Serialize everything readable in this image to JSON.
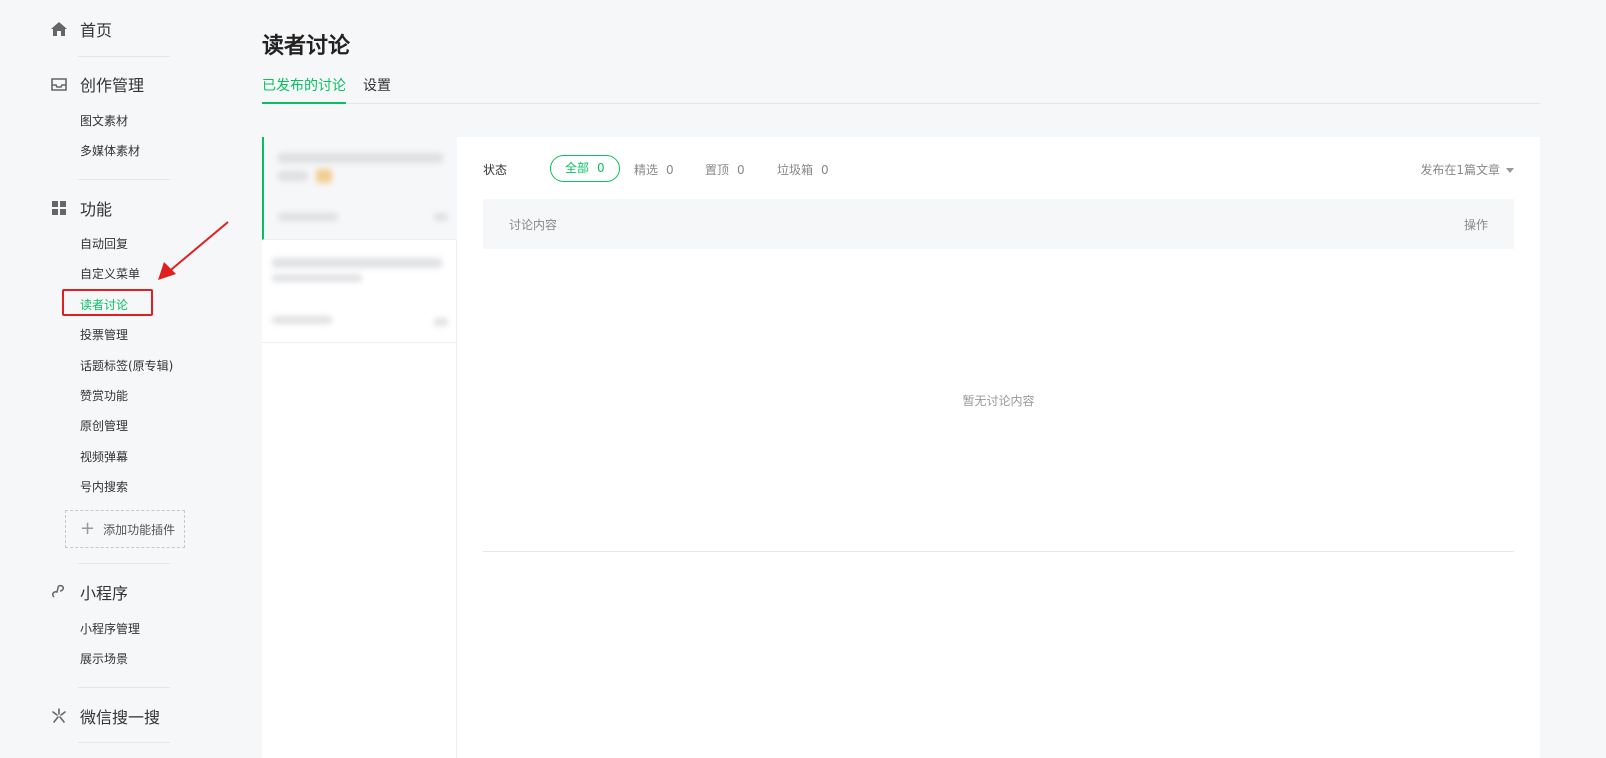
{
  "sidebar": {
    "home": {
      "label": "首页",
      "icon": "home-icon"
    },
    "creation": {
      "label": "创作管理",
      "icon": "inbox-icon",
      "items": [
        "图文素材",
        "多媒体素材"
      ]
    },
    "features": {
      "label": "功能",
      "icon": "grid-icon",
      "items": [
        "自动回复",
        "自定义菜单",
        "读者讨论",
        "投票管理",
        "话题标签(原专辑)",
        "赞赏功能",
        "原创管理",
        "视频弹幕",
        "号内搜索"
      ],
      "active_index": 2,
      "add_plugin_label": "添加功能插件"
    },
    "miniprogram": {
      "label": "小程序",
      "icon": "link-icon",
      "items": [
        "小程序管理",
        "展示场景"
      ]
    },
    "search": {
      "label": "微信搜一搜",
      "icon": "sparkle-icon"
    }
  },
  "main": {
    "title": "读者讨论",
    "tabs": [
      {
        "label": "已发布的讨论",
        "active": true
      },
      {
        "label": "设置",
        "active": false
      }
    ],
    "filter": {
      "label": "状态",
      "options": [
        {
          "label": "全部",
          "count": "0",
          "active": true
        },
        {
          "label": "精选",
          "count": "0"
        },
        {
          "label": "置顶",
          "count": "0"
        },
        {
          "label": "垃圾箱",
          "count": "0"
        }
      ],
      "sort_label": "发布在1篇文章"
    },
    "table": {
      "col_content": "讨论内容",
      "col_action": "操作",
      "empty_text": "暂无讨论内容"
    }
  },
  "colors": {
    "accent": "#07c160",
    "highlight": "#e02020"
  }
}
